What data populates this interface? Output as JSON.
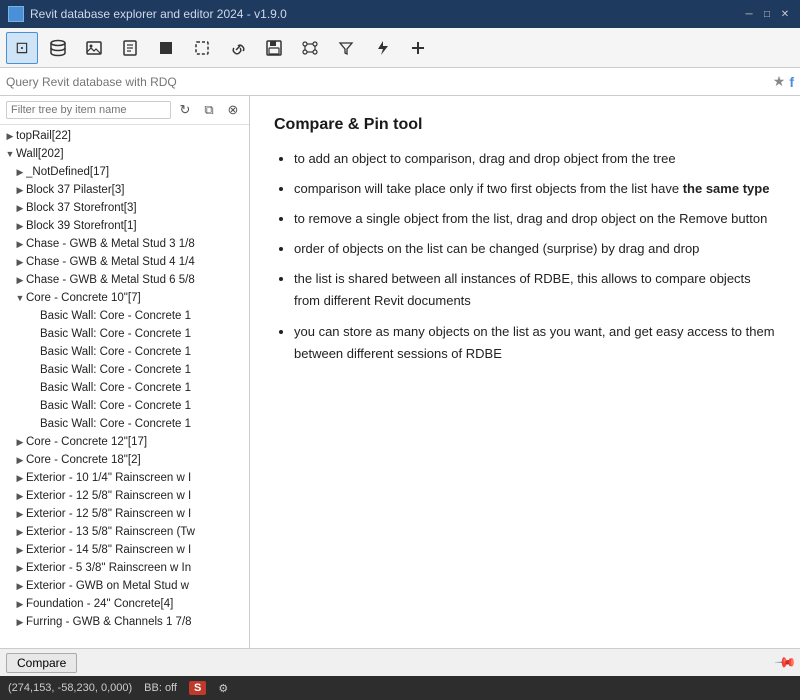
{
  "titlebar": {
    "app_icon": "R",
    "title": "Revit database explorer and editor 2024 - v1.9.0",
    "center_bar": "─────",
    "minimize": "─",
    "maximize": "□",
    "close": "✕"
  },
  "toolbar": {
    "buttons": [
      {
        "name": "search-tool",
        "icon": "⊡",
        "label": "Search"
      },
      {
        "name": "database-tool",
        "icon": "🗄",
        "label": "Database"
      },
      {
        "name": "image-tool",
        "icon": "🖼",
        "label": "Image"
      },
      {
        "name": "doc-tool",
        "icon": "📄",
        "label": "Document"
      },
      {
        "name": "square-tool",
        "icon": "■",
        "label": "Square"
      },
      {
        "name": "dotted-tool",
        "icon": "⬚",
        "label": "Dotted"
      },
      {
        "name": "link-tool",
        "icon": "🔗",
        "label": "Link"
      },
      {
        "name": "save-tool",
        "icon": "💾",
        "label": "Save"
      },
      {
        "name": "branch-tool",
        "icon": "⌥",
        "label": "Branch"
      },
      {
        "name": "filter-tool",
        "icon": "⏳",
        "label": "Filter"
      },
      {
        "name": "lightning-tool",
        "icon": "⚡",
        "label": "Lightning"
      },
      {
        "name": "plus-tool",
        "icon": "➕",
        "label": "Plus"
      }
    ]
  },
  "search": {
    "placeholder": "Query Revit database with RDQ",
    "star": "★",
    "f": "f"
  },
  "filter": {
    "placeholder": "Filter tree by item name",
    "refresh_icon": "↻",
    "copy_icon": "⧉",
    "pin_icon": "⊗"
  },
  "tree": {
    "items": [
      {
        "id": "topwall",
        "label": "topRail[22]",
        "indent": 0,
        "expanded": false,
        "has_children": true
      },
      {
        "id": "wall202",
        "label": "Wall[202]",
        "indent": 0,
        "expanded": true,
        "has_children": true
      },
      {
        "id": "not_def",
        "label": "_NotDefined[17]",
        "indent": 1,
        "expanded": false,
        "has_children": true
      },
      {
        "id": "block37p",
        "label": "Block 37 Pilaster[3]",
        "indent": 1,
        "expanded": false,
        "has_children": true
      },
      {
        "id": "block37s",
        "label": "Block 37 Storefront[3]",
        "indent": 1,
        "expanded": false,
        "has_children": true
      },
      {
        "id": "block39s",
        "label": "Block 39 Storefront[1]",
        "indent": 1,
        "expanded": false,
        "has_children": true
      },
      {
        "id": "chase1",
        "label": "Chase - GWB & Metal Stud 3 1/8",
        "indent": 1,
        "expanded": false,
        "has_children": true
      },
      {
        "id": "chase2",
        "label": "Chase - GWB & Metal Stud 4 1/4",
        "indent": 1,
        "expanded": false,
        "has_children": true
      },
      {
        "id": "chase3",
        "label": "Chase - GWB & Metal Stud 6 5/8",
        "indent": 1,
        "expanded": false,
        "has_children": true
      },
      {
        "id": "core10",
        "label": "Core - Concrete 10\"[7]",
        "indent": 1,
        "expanded": true,
        "has_children": true
      },
      {
        "id": "core10_1",
        "label": "Basic Wall: Core - Concrete 1",
        "indent": 2,
        "expanded": false,
        "has_children": false
      },
      {
        "id": "core10_2",
        "label": "Basic Wall: Core - Concrete 1",
        "indent": 2,
        "expanded": false,
        "has_children": false
      },
      {
        "id": "core10_3",
        "label": "Basic Wall: Core - Concrete 1",
        "indent": 2,
        "expanded": false,
        "has_children": false
      },
      {
        "id": "core10_4",
        "label": "Basic Wall: Core - Concrete 1",
        "indent": 2,
        "expanded": false,
        "has_children": false
      },
      {
        "id": "core10_5",
        "label": "Basic Wall: Core - Concrete 1",
        "indent": 2,
        "expanded": false,
        "has_children": false
      },
      {
        "id": "core10_6",
        "label": "Basic Wall: Core - Concrete 1",
        "indent": 2,
        "expanded": false,
        "has_children": false
      },
      {
        "id": "core10_7",
        "label": "Basic Wall: Core - Concrete 1",
        "indent": 2,
        "expanded": false,
        "has_children": false
      },
      {
        "id": "core12",
        "label": "Core - Concrete 12\"[17]",
        "indent": 1,
        "expanded": false,
        "has_children": true
      },
      {
        "id": "core18",
        "label": "Core - Concrete 18\"[2]",
        "indent": 1,
        "expanded": false,
        "has_children": true
      },
      {
        "id": "ext1",
        "label": "Exterior - 10 1/4\" Rainscreen w I",
        "indent": 1,
        "expanded": false,
        "has_children": true
      },
      {
        "id": "ext2",
        "label": "Exterior - 12 5/8\" Rainscreen w I",
        "indent": 1,
        "expanded": false,
        "has_children": true
      },
      {
        "id": "ext3",
        "label": "Exterior - 12 5/8\" Rainscreen w I",
        "indent": 1,
        "expanded": false,
        "has_children": true
      },
      {
        "id": "ext4",
        "label": "Exterior - 13 5/8\" Rainscreen (Tw",
        "indent": 1,
        "expanded": false,
        "has_children": true
      },
      {
        "id": "ext5",
        "label": "Exterior - 14 5/8\" Rainscreen w I",
        "indent": 1,
        "expanded": false,
        "has_children": true
      },
      {
        "id": "ext6",
        "label": "Exterior - 5 3/8\" Rainscreen w In",
        "indent": 1,
        "expanded": false,
        "has_children": true
      },
      {
        "id": "ext7",
        "label": "Exterior - GWB on Metal Stud w",
        "indent": 1,
        "expanded": false,
        "has_children": true
      },
      {
        "id": "found",
        "label": "Foundation - 24\" Concrete[4]",
        "indent": 1,
        "expanded": false,
        "has_children": true
      },
      {
        "id": "furring",
        "label": "Furring - GWB & Channels 1 7/8",
        "indent": 1,
        "expanded": false,
        "has_children": true
      }
    ]
  },
  "right_panel": {
    "title": "Compare & Pin tool",
    "bullets": [
      {
        "text": "to add an object to comparison, drag and drop object from the tree",
        "bold": null
      },
      {
        "text": "comparison will take place only if two first objects from the list have ",
        "bold": "the same type",
        "bold_inline": true
      },
      {
        "text": "to remove a single object from the list, drag and drop object on the Remove button",
        "bold": null
      },
      {
        "text": "order of objects on the list can be changed (surprise) by drag and drop",
        "bold": null
      },
      {
        "text": "the list is shared between all instances of RDBE, this allows to compare objects from different Revit documents",
        "bold": null
      },
      {
        "text": "you can store as many objects on the list as you want, and get easy access to them between different sessions of RDBE",
        "bold": null
      }
    ]
  },
  "bottom": {
    "compare_label": "Compare",
    "pin_icon": "📌"
  },
  "statusbar": {
    "coords": "(274,153, -58,230, 0,000)",
    "bb": "BB: off",
    "s_badge": "S",
    "gear": "⚙"
  }
}
